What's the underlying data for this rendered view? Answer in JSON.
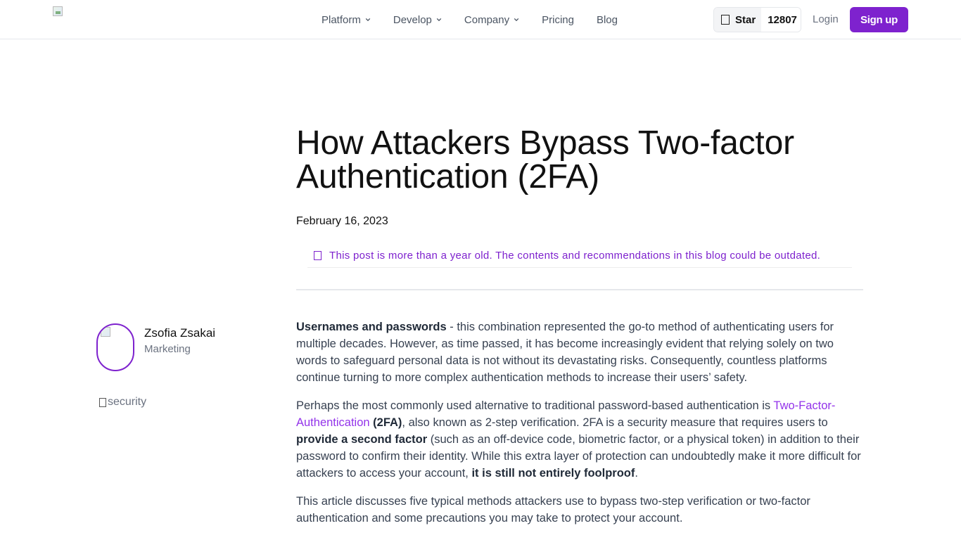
{
  "header": {
    "nav": [
      {
        "label": "Platform",
        "dropdown": true
      },
      {
        "label": "Develop",
        "dropdown": true
      },
      {
        "label": "Company",
        "dropdown": true
      },
      {
        "label": "Pricing",
        "dropdown": false
      },
      {
        "label": "Blog",
        "dropdown": false
      }
    ],
    "star_label": "Star",
    "star_count": "12807",
    "login_label": "Login",
    "signup_label": "Sign up"
  },
  "article": {
    "title": "How Attackers Bypass Two-factor Authentication (2FA)",
    "date": "February 16, 2023",
    "notice": "This post is more than a year old. The contents and recommendations in this blog could be outdated.",
    "author": {
      "name": "Zsofia Zsakai",
      "role": "Marketing"
    },
    "tag": "security",
    "p1": {
      "bold": "Usernames and passwords",
      "text": " - this combination represented the go-to method of authenticating users for multiple decades. However, as time passed, it has become increasingly evident that relying solely on two words to safeguard personal data is not without its devastating risks. Consequently, countless platforms continue turning to more complex authentication methods to increase their users’ safety."
    },
    "p2": {
      "t1": "Perhaps the most commonly used alternative to traditional password-based authentication is ",
      "link": "Two-Factor-Authentication",
      "b1": " (2FA)",
      "t2": ", also known as 2-step verification. 2FA is a security measure that requires users to ",
      "b2": "provide a second factor",
      "t3": " (such as an off-device code, biometric factor, or a physical token) in addition to their password to confirm their identity. While this extra layer of protection can undoubtedly make it more difficult for attackers to access your account, ",
      "b3": "it is still not entirely foolproof",
      "t4": "."
    },
    "p3": "This article discusses five typical methods attackers use to bypass two-step verification or two-factor authentication and some precautions you may take to protect your account."
  },
  "colors": {
    "accent": "#7e22ce",
    "link": "#9333ea",
    "text": "#374151"
  }
}
